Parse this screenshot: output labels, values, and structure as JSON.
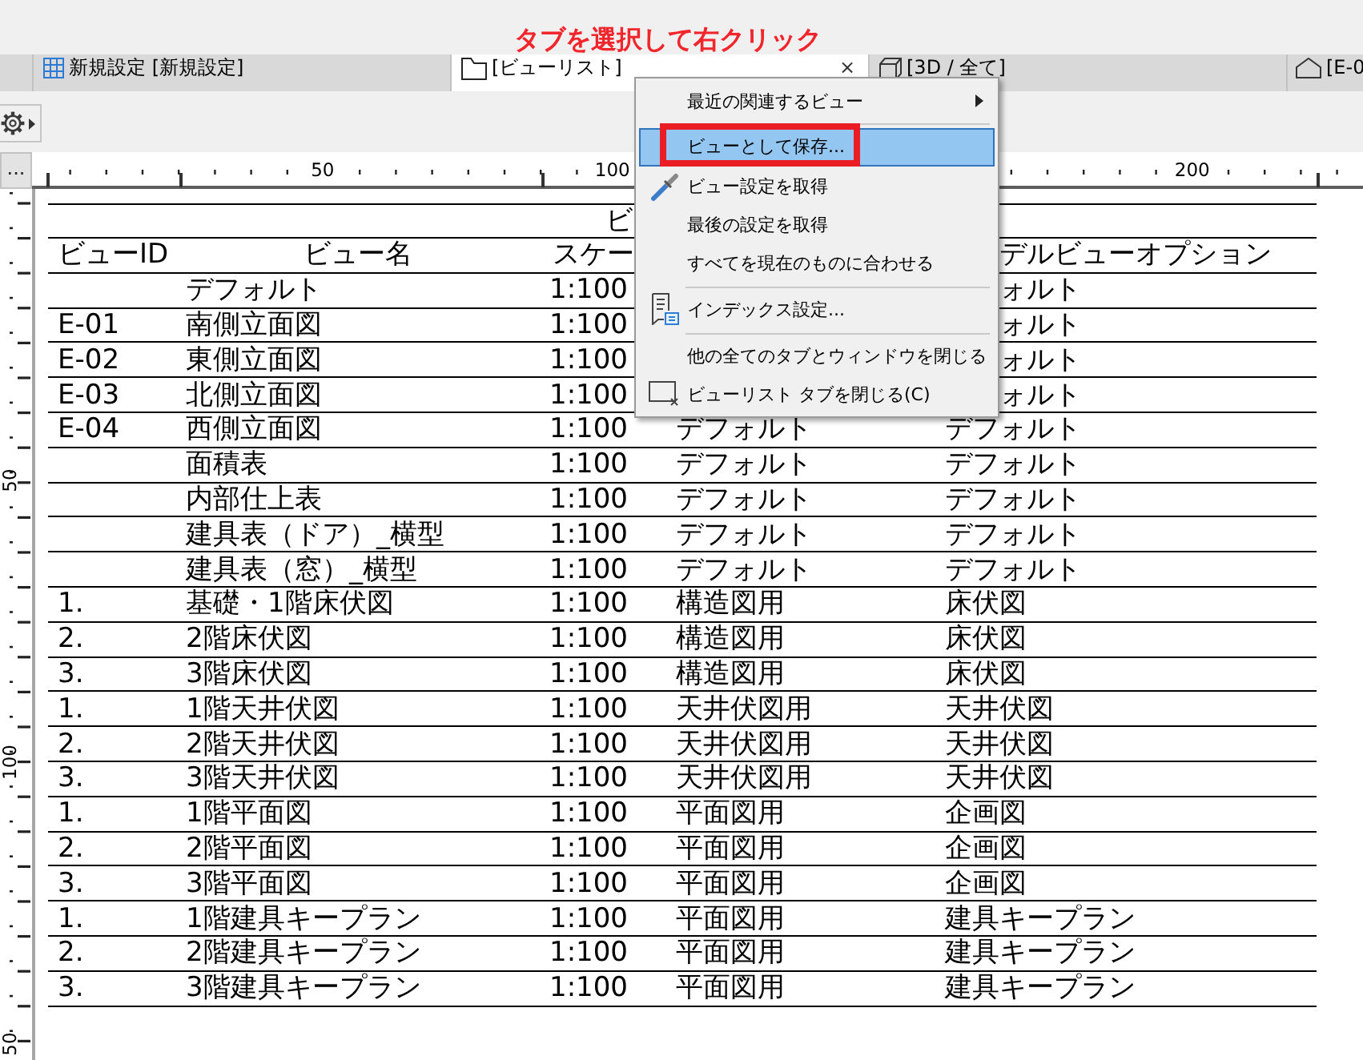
{
  "callout": {
    "text": "タブを選択して右クリック"
  },
  "tabs": [
    {
      "kind": "schedule",
      "label": "新規設定 [新規設定]",
      "selected": false
    },
    {
      "kind": "list",
      "label": "[ビューリスト]",
      "selected": true,
      "close_label": "×"
    },
    {
      "kind": "model",
      "label": "[3D / 全て]",
      "selected": false
    },
    {
      "kind": "elevation",
      "label": "[E-0",
      "selected": false
    }
  ],
  "rulers": {
    "corner_button": "...",
    "horizontal_labels": [
      "50",
      "100",
      "200"
    ],
    "vertical_labels": [
      "50",
      "100",
      "50"
    ]
  },
  "table": {
    "title": "ビ",
    "headers": {
      "view_id": "ビューID",
      "view_name": "ビュー名",
      "column_3": "スケー",
      "column_5": "デルビューオプション"
    },
    "rows": [
      {
        "view_name": "デフォルト",
        "column_3": "1:100",
        "column_5": "ォルト"
      },
      {
        "view_id": "E-01",
        "view_name": "南側立面図",
        "column_3": "1:100",
        "column_5": "ォルト"
      },
      {
        "view_id": "E-02",
        "view_name": "東側立面図",
        "column_3": "1:100",
        "column_5": "ォルト"
      },
      {
        "view_id": "E-03",
        "view_name": "北側立面図",
        "column_3": "1:100",
        "column_5": "ォルト"
      },
      {
        "view_id": "E-04",
        "view_name": "西側立面図",
        "column_3": "1:100",
        "column_4": "デフォルト",
        "column_5": "デフォルト"
      },
      {
        "view_name": "面積表",
        "column_3": "1:100",
        "column_4": "デフォルト",
        "column_5": "デフォルト"
      },
      {
        "view_name": "内部仕上表",
        "column_3": "1:100",
        "column_4": "デフォルト",
        "column_5": "デフォルト"
      },
      {
        "view_name": "建具表（ドア）_横型",
        "column_3": "1:100",
        "column_4": "デフォルト",
        "column_5": "デフォルト"
      },
      {
        "view_name": "建具表（窓）_横型",
        "column_3": "1:100",
        "column_4": "デフォルト",
        "column_5": "デフォルト"
      },
      {
        "view_id": "1.",
        "view_name": "基礎・1階床伏図",
        "column_3": "1:100",
        "column_4": "構造図用",
        "column_5": "床伏図"
      },
      {
        "view_id": "2.",
        "view_name": "2階床伏図",
        "column_3": "1:100",
        "column_4": "構造図用",
        "column_5": "床伏図"
      },
      {
        "view_id": "3.",
        "view_name": "3階床伏図",
        "column_3": "1:100",
        "column_4": "構造図用",
        "column_5": "床伏図"
      },
      {
        "view_id": "1.",
        "view_name": "1階天井伏図",
        "column_3": "1:100",
        "column_4": "天井伏図用",
        "column_5": "天井伏図"
      },
      {
        "view_id": "2.",
        "view_name": "2階天井伏図",
        "column_3": "1:100",
        "column_4": "天井伏図用",
        "column_5": "天井伏図"
      },
      {
        "view_id": "3.",
        "view_name": "3階天井伏図",
        "column_3": "1:100",
        "column_4": "天井伏図用",
        "column_5": "天井伏図"
      },
      {
        "view_id": "1.",
        "view_name": "1階平面図",
        "column_3": "1:100",
        "column_4": "平面図用",
        "column_5": "企画図"
      },
      {
        "view_id": "2.",
        "view_name": "2階平面図",
        "column_3": "1:100",
        "column_4": "平面図用",
        "column_5": "企画図"
      },
      {
        "view_id": "3.",
        "view_name": "3階平面図",
        "column_3": "1:100",
        "column_4": "平面図用",
        "column_5": "企画図"
      },
      {
        "view_id": "1.",
        "view_name": "1階建具キープラン",
        "column_3": "1:100",
        "column_4": "平面図用",
        "column_5": "建具キープラン"
      },
      {
        "view_id": "2.",
        "view_name": "2階建具キープラン",
        "column_3": "1:100",
        "column_4": "平面図用",
        "column_5": "建具キープラン"
      },
      {
        "view_id": "3.",
        "view_name": "3階建具キープラン",
        "column_3": "1:100",
        "column_4": "平面図用",
        "column_5": "建具キープラン"
      }
    ]
  },
  "context_menu": {
    "items": [
      {
        "kind": "command",
        "label": "最近の関連するビュー",
        "submenu": true,
        "selected": false,
        "framed": false
      },
      {
        "kind": "separator"
      },
      {
        "kind": "command",
        "label": "ビューとして保存...",
        "submenu": false,
        "selected": true,
        "framed": true
      },
      {
        "kind": "picker",
        "label": "ビュー設定を取得",
        "submenu": false,
        "selected": false,
        "framed": false
      },
      {
        "kind": "command",
        "label": "最後の設定を取得",
        "submenu": false,
        "selected": false,
        "framed": false
      },
      {
        "kind": "command",
        "label": "すべてを現在のものに合わせる",
        "submenu": false,
        "selected": false,
        "framed": false
      },
      {
        "kind": "separator"
      },
      {
        "kind": "index",
        "label": "インデックス設定...",
        "submenu": false,
        "selected": false,
        "framed": false
      },
      {
        "kind": "separator"
      },
      {
        "kind": "command",
        "label": "他の全てのタブとウィンドウを閉じる",
        "submenu": false,
        "selected": false,
        "framed": false
      },
      {
        "kind": "close",
        "label": "ビューリスト タブを閉じる(C)",
        "submenu": false,
        "selected": false,
        "framed": false
      }
    ]
  }
}
